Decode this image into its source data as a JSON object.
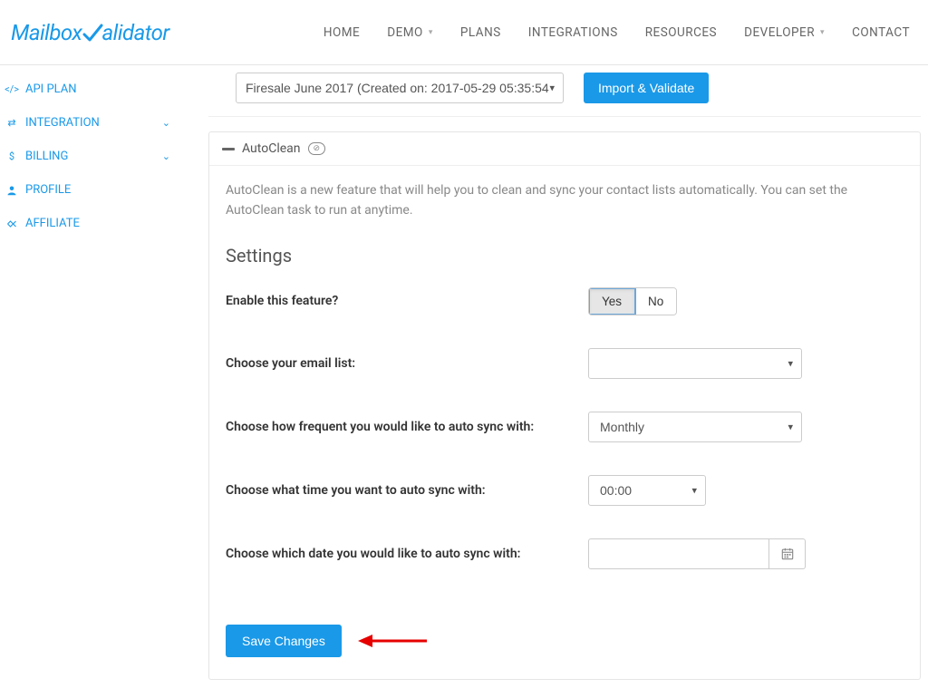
{
  "logo_text_m": "M",
  "logo_text_rest": "ailbox",
  "logo_text_end": "alidator",
  "nav": {
    "home": "HOME",
    "demo": "DEMO",
    "plans": "PLANS",
    "integrations": "INTEGRATIONS",
    "resources": "RESOURCES",
    "developer": "DEVELOPER",
    "contact": "CONTACT"
  },
  "sidebar": {
    "api_plan": "API PLAN",
    "integration": "INTEGRATION",
    "billing": "BILLING",
    "profile": "PROFILE",
    "affiliate": "AFFILIATE"
  },
  "import_row": {
    "selected": "Firesale June 2017 (Created on: 2017-05-29 05:35:54",
    "button": "Import & Validate"
  },
  "panel": {
    "title": "AutoClean",
    "desc": "AutoClean is a new feature that will help you to clean and sync your contact lists automatically. You can set the AutoClean task to run at anytime."
  },
  "settings": {
    "heading": "Settings",
    "enable_label": "Enable this feature?",
    "yes": "Yes",
    "no": "No",
    "email_list_label": "Choose your email list:",
    "email_list_value": "",
    "frequency_label": "Choose how frequent you would like to auto sync with:",
    "frequency_value": "Monthly",
    "time_label": "Choose what time you want to auto sync with:",
    "time_value": "00:00",
    "date_label": "Choose which date you would like to auto sync with:",
    "date_value": "",
    "save": "Save Changes"
  }
}
